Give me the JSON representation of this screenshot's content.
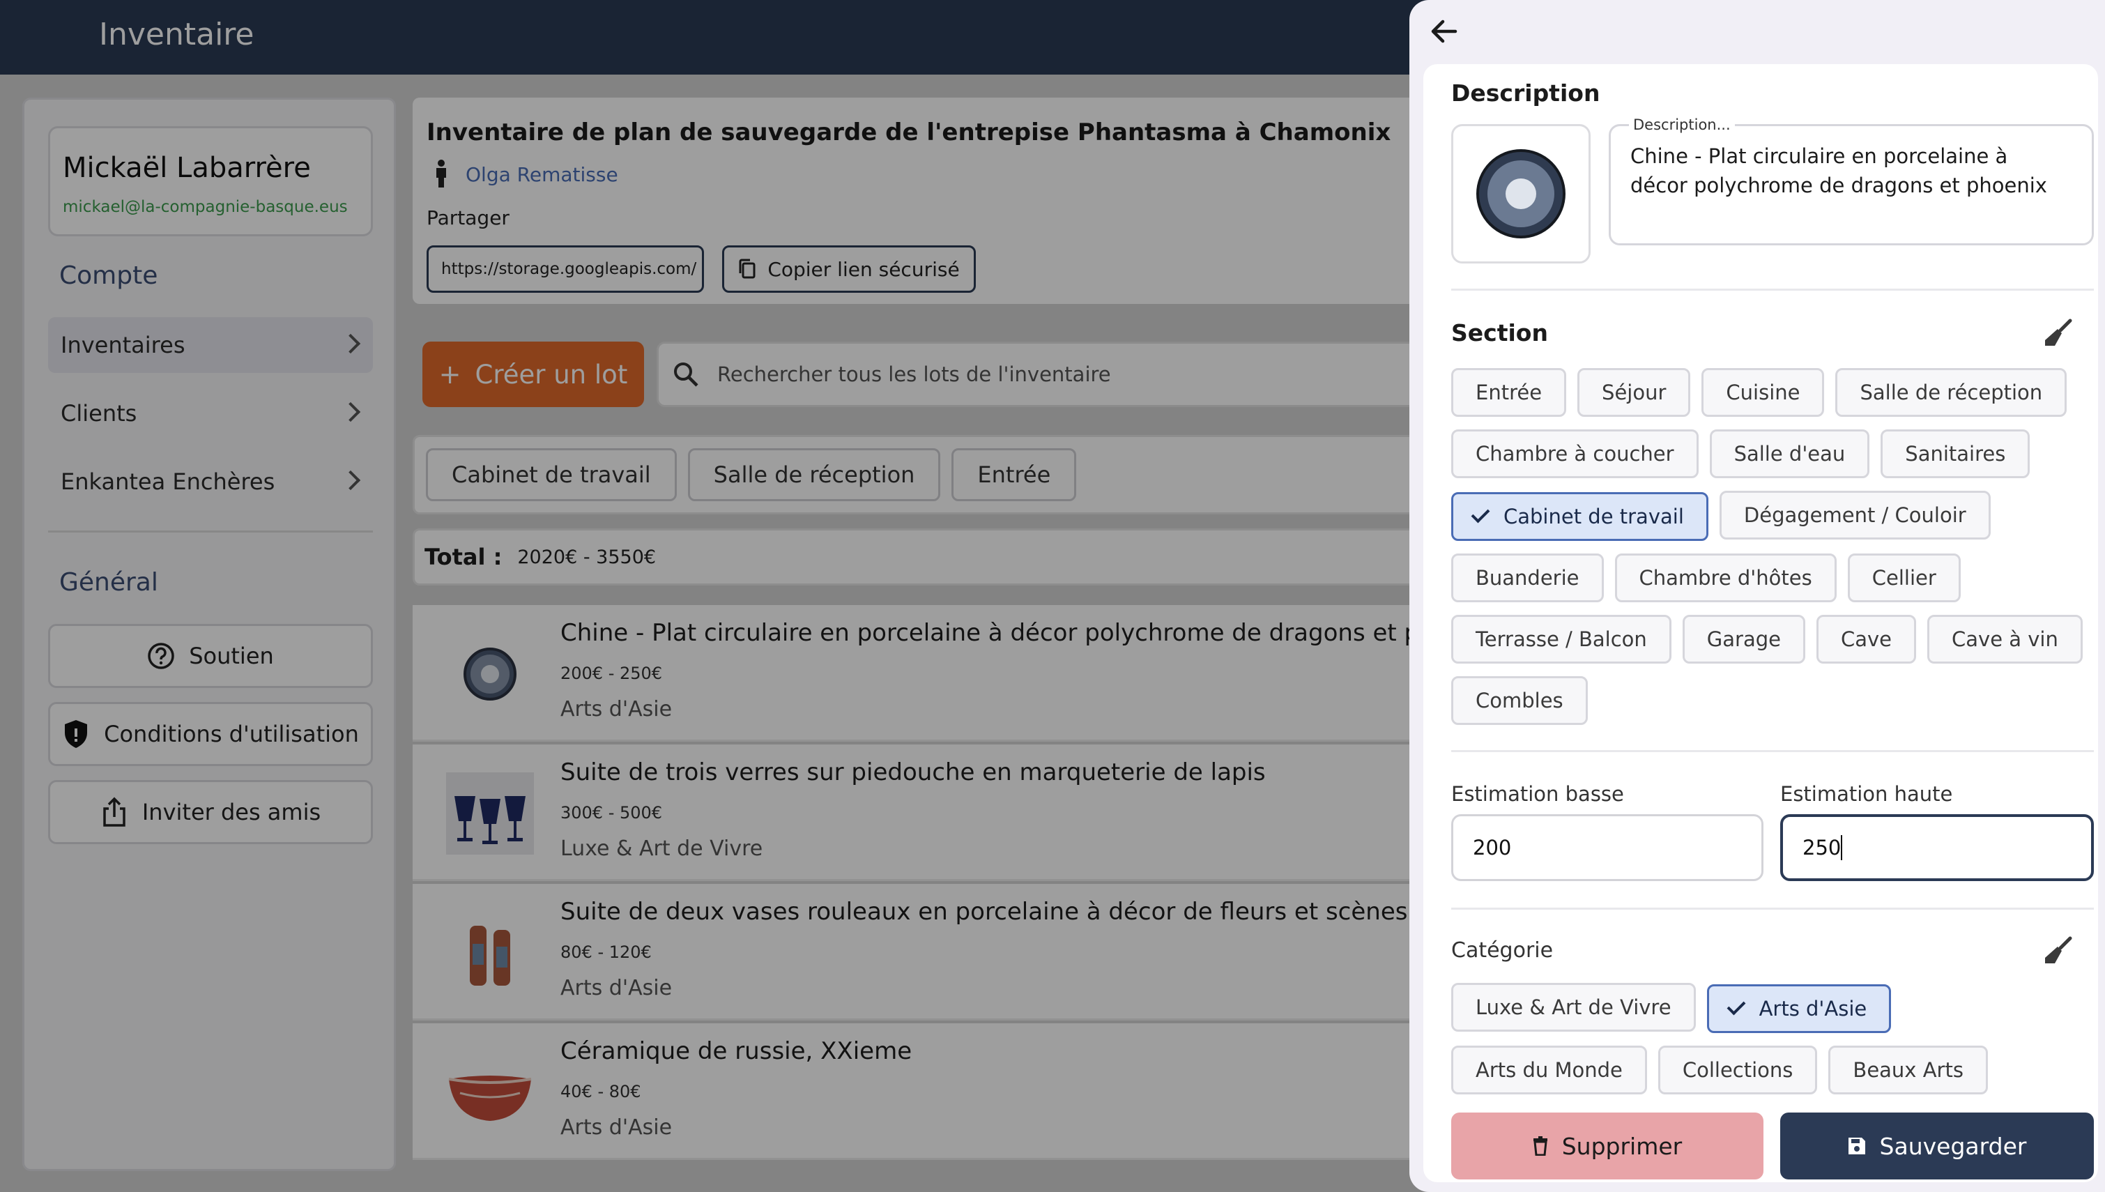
{
  "app": {
    "title": "Inventaire"
  },
  "user": {
    "name": "Mickaël Labarrère",
    "email": "mickael@la-compagnie-basque.eus"
  },
  "sidebar": {
    "section_account": "Compte",
    "items": [
      {
        "label": "Inventaires",
        "active": true
      },
      {
        "label": "Clients",
        "active": false
      },
      {
        "label": "Enkantea Enchères",
        "active": false
      }
    ],
    "section_general": "Général",
    "buttons": [
      {
        "label": "Soutien",
        "icon": "help-circle-icon"
      },
      {
        "label": "Conditions d'utilisation",
        "icon": "shield-icon"
      },
      {
        "label": "Inviter des amis",
        "icon": "share-icon"
      }
    ]
  },
  "inventory": {
    "title": "Inventaire de plan de sauvegarde de l'entrepise Phantasma à Chamonix",
    "owner": "Olga Rematisse",
    "share_label": "Partager",
    "share_url": "https://storage.googleapis.com/",
    "copy_label": "Copier lien sécurisé",
    "create_label": "Créer un lot",
    "search_placeholder": "Rechercher tous les lots de l'inventaire",
    "filters": [
      "Cabinet de travail",
      "Salle de réception",
      "Entrée"
    ],
    "total_label": "Total :",
    "total_value": "2020€ - 3550€",
    "lots": [
      {
        "title": "Chine - Plat circulaire en porcelaine à décor polychrome de dragons et phoenix",
        "price": "200€ - 250€",
        "category": "Arts d'Asie"
      },
      {
        "title": "Suite de trois verres sur piedouche en marqueterie de lapis",
        "price": "300€ - 500€",
        "category": "Luxe & Art de Vivre"
      },
      {
        "title": "Suite de deux vases rouleaux en porcelaine à décor de fleurs et scènes de cour d",
        "price": "80€ - 120€",
        "category": "Arts d'Asie"
      },
      {
        "title": "Céramique de russie, XXieme",
        "price": "40€ - 80€",
        "category": "Arts d'Asie"
      }
    ]
  },
  "drawer": {
    "description_heading": "Description",
    "description_label": "Description...",
    "description_value": "Chine - Plat circulaire en porcelaine à décor polychrome de dragons et phoenix",
    "section_heading": "Section",
    "sections": [
      {
        "label": "Entrée",
        "selected": false
      },
      {
        "label": "Séjour",
        "selected": false
      },
      {
        "label": "Cuisine",
        "selected": false
      },
      {
        "label": "Salle de réception",
        "selected": false
      },
      {
        "label": "Chambre à coucher",
        "selected": false
      },
      {
        "label": "Salle d'eau",
        "selected": false
      },
      {
        "label": "Sanitaires",
        "selected": false
      },
      {
        "label": "Cabinet de travail",
        "selected": true
      },
      {
        "label": "Dégagement / Couloir",
        "selected": false
      },
      {
        "label": "Buanderie",
        "selected": false
      },
      {
        "label": "Chambre d'hôtes",
        "selected": false
      },
      {
        "label": "Cellier",
        "selected": false
      },
      {
        "label": "Terrasse / Balcon",
        "selected": false
      },
      {
        "label": "Garage",
        "selected": false
      },
      {
        "label": "Cave",
        "selected": false
      },
      {
        "label": "Cave à vin",
        "selected": false
      },
      {
        "label": "Combles",
        "selected": false
      }
    ],
    "estimate_low_label": "Estimation basse",
    "estimate_low_value": "200",
    "estimate_high_label": "Estimation haute",
    "estimate_high_value": "250",
    "category_heading": "Catégorie",
    "categories": [
      {
        "label": "Luxe & Art de Vivre",
        "selected": false
      },
      {
        "label": "Arts d'Asie",
        "selected": true
      },
      {
        "label": "Arts du Monde",
        "selected": false
      },
      {
        "label": "Collections",
        "selected": false
      },
      {
        "label": "Beaux Arts",
        "selected": false
      }
    ],
    "delete_label": "Supprimer",
    "save_label": "Sauvegarder"
  },
  "colors": {
    "navy": "#2b3a55",
    "orange": "#e06a2a",
    "delete": "#e8a4a8",
    "select_bg": "#dce6f8"
  }
}
